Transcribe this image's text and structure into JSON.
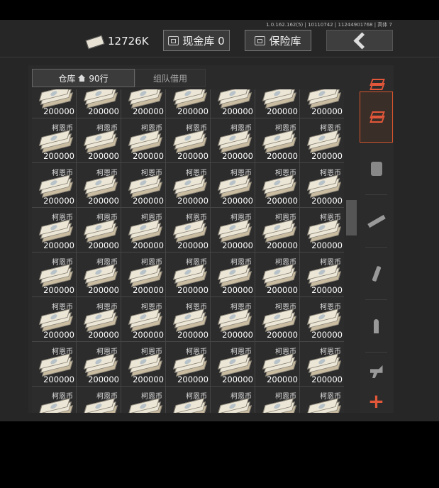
{
  "version_text": "1.0.162.162(5) | 10110742 | 11244901768 | 高体 7",
  "header": {
    "currency_value": "12726K",
    "cash_vault_label": "现金库 0",
    "safe_label": "保险库"
  },
  "tabs": {
    "warehouse_label": "仓库",
    "warehouse_rows": "90行",
    "team_borrow_label": "组队借用"
  },
  "inventory": {
    "item_name": "柯恩币",
    "item_quantity": "200000",
    "columns": 7,
    "visible_rows": 8
  },
  "sidebar": {
    "categories": [
      "all-items",
      "armor",
      "rifle",
      "magazine",
      "ammo",
      "grip"
    ],
    "active_category": "all-items",
    "add_label": "+"
  },
  "colors": {
    "accent": "#e2573a",
    "background": "#262626",
    "panel": "#2a2a2a"
  }
}
